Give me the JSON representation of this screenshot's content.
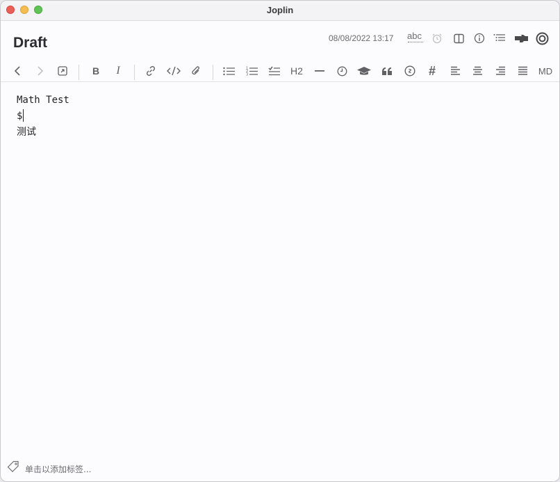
{
  "window": {
    "title": "Joplin"
  },
  "note": {
    "title": "Draft",
    "date": "08/08/2022 13:17"
  },
  "header_icons": [
    "spellcheck-icon",
    "alarm-icon",
    "layout-icon",
    "info-icon",
    "toc-icon",
    "pointer-icon",
    "target-icon"
  ],
  "header_text": {
    "spellcheck": "abc"
  },
  "toolbar": {
    "heading_label": "H2",
    "markdown_label": "MD"
  },
  "editor": {
    "lines": [
      "Math Test",
      "$",
      "测试"
    ]
  },
  "footer": {
    "tag_placeholder": "单击以添加标签..."
  },
  "colors": {
    "icon": "#626266",
    "background": "#fcfbfe",
    "close": "#ec5f57",
    "minimize": "#f5bd4f",
    "maximize": "#5fc453"
  }
}
